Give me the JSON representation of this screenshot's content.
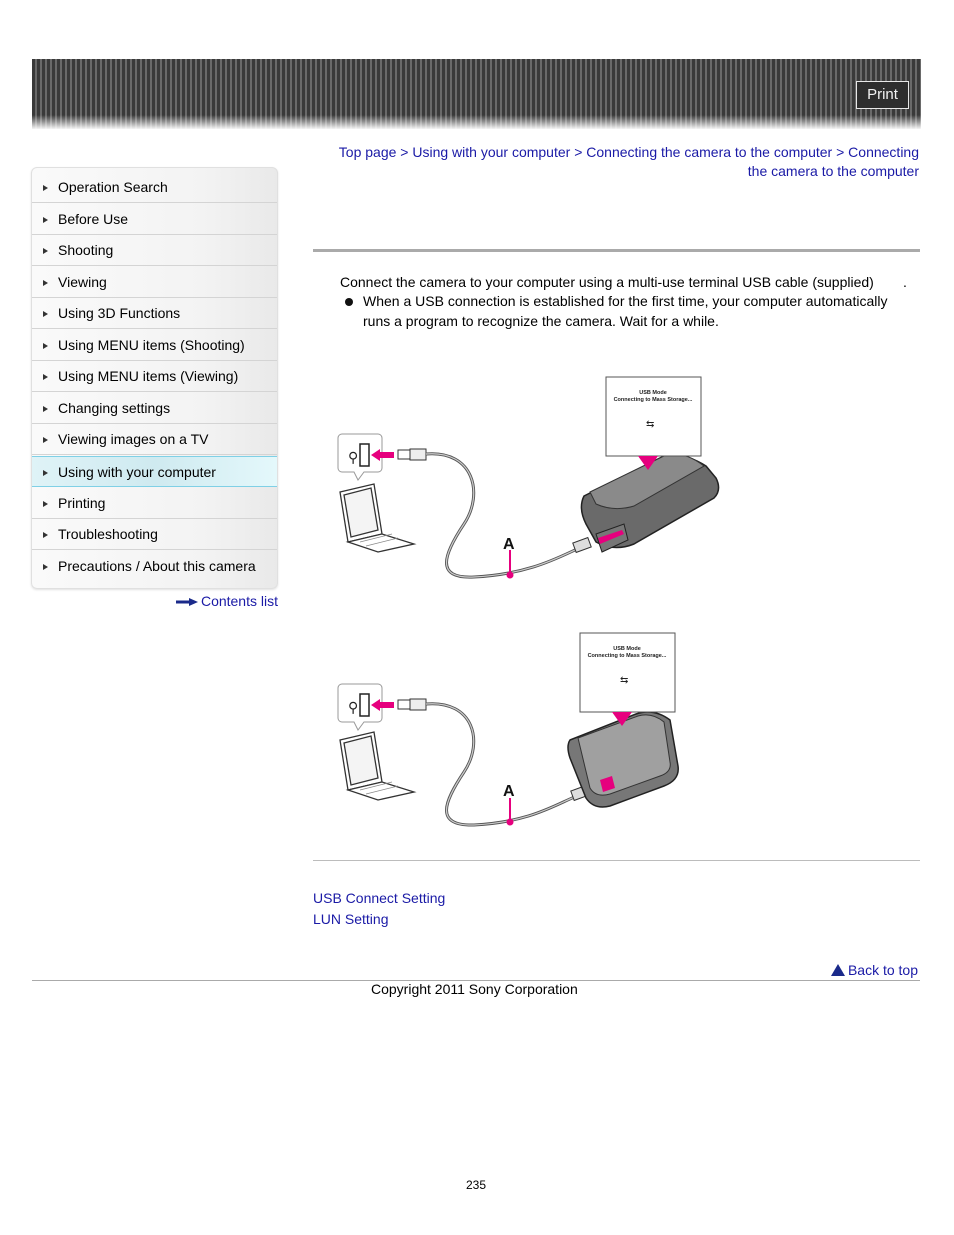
{
  "header": {
    "print_label": "Print"
  },
  "sidebar": {
    "items": [
      {
        "label": "Operation Search",
        "active": false
      },
      {
        "label": "Before Use",
        "active": false
      },
      {
        "label": "Shooting",
        "active": false
      },
      {
        "label": "Viewing",
        "active": false
      },
      {
        "label": "Using 3D Functions",
        "active": false
      },
      {
        "label": "Using MENU items (Shooting)",
        "active": false
      },
      {
        "label": "Using MENU items (Viewing)",
        "active": false
      },
      {
        "label": "Changing settings",
        "active": false
      },
      {
        "label": "Viewing images on a TV",
        "active": false
      },
      {
        "label": "Using with your computer",
        "active": true
      },
      {
        "label": "Printing",
        "active": false
      },
      {
        "label": "Troubleshooting",
        "active": false
      },
      {
        "label": "Precautions / About this camera",
        "active": false
      }
    ],
    "contents_list_label": "Contents list"
  },
  "breadcrumb": {
    "items": [
      "Top page",
      "Using with your computer",
      "Connecting the camera to the computer",
      "Connecting the camera to the computer"
    ],
    "separator": ">"
  },
  "content": {
    "intro": "Connect the camera to your computer using a multi-use terminal USB cable (supplied)",
    "intro_end": ".",
    "bullet": "When a USB connection is established for the first time, your computer automatically runs a program to recognize the camera. Wait for a while.",
    "figures": [
      {
        "screen_line1": "USB Mode",
        "screen_line2": "Connecting to Mass Storage...",
        "cable_label": "A"
      },
      {
        "screen_line1": "USB Mode",
        "screen_line2": "Connecting to Mass Storage...",
        "cable_label": "A"
      }
    ]
  },
  "related_links": [
    "USB Connect Setting",
    "LUN Setting"
  ],
  "footer": {
    "back_to_top": "Back to top",
    "copyright": "Copyright 2011 Sony Corporation",
    "page_number": "235"
  },
  "colors": {
    "link": "#1a1aa6",
    "accent_pink": "#e6007e",
    "active_nav_border": "#7fd0e6"
  }
}
